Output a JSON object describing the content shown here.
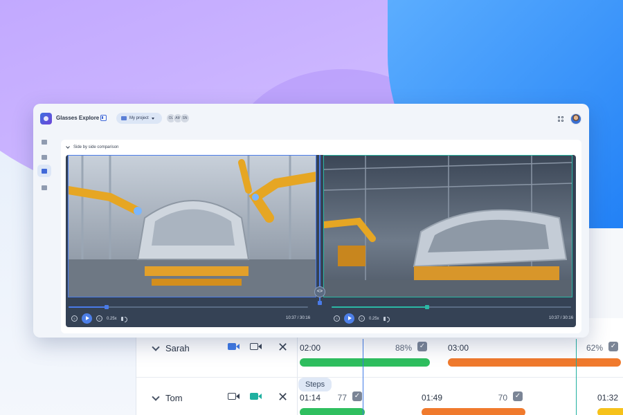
{
  "app": {
    "name": "Glasses Explore"
  },
  "project": {
    "label": "My project"
  },
  "collaborators": [
    "OL",
    "AM",
    "SN"
  ],
  "section": {
    "title": "Side by side comparison"
  },
  "players": [
    {
      "speed": "0.25x",
      "time": "10:37 / 30:16",
      "progress": 0.16,
      "accent": "#4a7be8"
    },
    {
      "speed": "0.25x",
      "time": "10:37 / 30:16",
      "progress": 0.4,
      "accent": "#2bb9a5"
    }
  ],
  "split_handle": {
    "icon": "<>"
  },
  "timeline": {
    "steps_label": "Steps",
    "rows": [
      {
        "name": "Sarah",
        "segments": [
          {
            "time": "02:00",
            "percent": "88%",
            "color": "#2fbf5f"
          },
          {
            "time": "03:00",
            "percent": "62%",
            "color": "#f07a2d"
          }
        ]
      },
      {
        "name": "Tom",
        "segments": [
          {
            "time": "01:14",
            "percent": "77",
            "color": "#2fbf5f"
          },
          {
            "time": "01:49",
            "percent": "70",
            "color": "#f07a2d"
          },
          {
            "time": "01:32",
            "percent": "",
            "color": "#f6c21b"
          }
        ]
      }
    ]
  },
  "icons": {
    "logo": "logo-icon",
    "panel": "sidebar-toggle-icon",
    "folder": "folder-icon",
    "grid": "grid-icon",
    "check": "✓",
    "close": "✕"
  },
  "colors": {
    "brand": "#4169d8",
    "compare_left": "#4a7be8",
    "compare_right": "#2bb9a5"
  }
}
